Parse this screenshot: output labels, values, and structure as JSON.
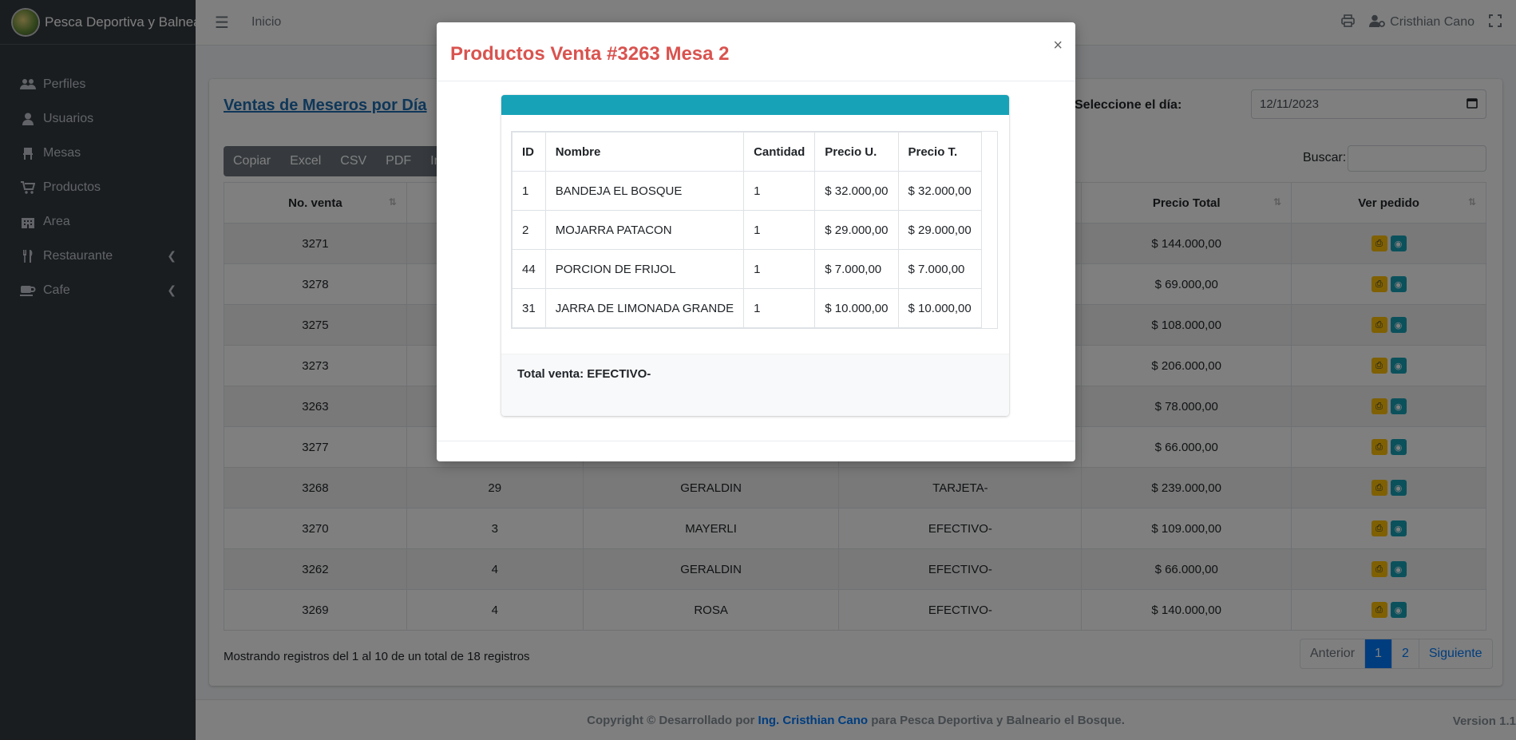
{
  "brand": {
    "title": "Pesca Deportiva y Balneari"
  },
  "sidebar": {
    "items": [
      {
        "label": "Perfiles",
        "icon": "users-icon"
      },
      {
        "label": "Usuarios",
        "icon": "user-icon"
      },
      {
        "label": "Mesas",
        "icon": "chair-icon"
      },
      {
        "label": "Productos",
        "icon": "cart-icon"
      },
      {
        "label": "Area",
        "icon": "building-icon"
      },
      {
        "label": "Restaurante",
        "icon": "utensils-icon"
      },
      {
        "label": "Cafe",
        "icon": "coffee-icon"
      }
    ]
  },
  "topbar": {
    "home": "Inicio",
    "user": "Cristhian Cano"
  },
  "page": {
    "title": "Ventas de Meseros por Día",
    "day_label": "Seleccione el día:",
    "date_value": "12/11/2023",
    "search_label": "Buscar:",
    "export_buttons": [
      "Copiar",
      "Excel",
      "CSV",
      "PDF",
      "Imp"
    ]
  },
  "table": {
    "headers": {
      "c1": "No. venta",
      "c5": "Precio Total",
      "c6": "Ver pedido"
    },
    "rows": [
      {
        "venta": "3271",
        "mesa": "",
        "mesero": "",
        "pago": "",
        "total": "$ 144.000,00"
      },
      {
        "venta": "3278",
        "mesa": "",
        "mesero": "",
        "pago": "",
        "total": "$ 69.000,00"
      },
      {
        "venta": "3275",
        "mesa": "",
        "mesero": "",
        "pago": "",
        "total": "$ 108.000,00"
      },
      {
        "venta": "3273",
        "mesa": "",
        "mesero": "",
        "pago": "",
        "total": "$ 206.000,00"
      },
      {
        "venta": "3263",
        "mesa": "",
        "mesero": "",
        "pago": "",
        "total": "$ 78.000,00"
      },
      {
        "venta": "3277",
        "mesa": "",
        "mesero": "",
        "pago": "",
        "total": "$ 66.000,00"
      },
      {
        "venta": "3268",
        "mesa": "29",
        "mesero": "GERALDIN",
        "pago": "TARJETA-",
        "total": "$ 239.000,00"
      },
      {
        "venta": "3270",
        "mesa": "3",
        "mesero": "MAYERLI",
        "pago": "EFECTIVO-",
        "total": "$ 109.000,00"
      },
      {
        "venta": "3262",
        "mesa": "4",
        "mesero": "GERALDIN",
        "pago": "EFECTIVO-",
        "total": "$ 66.000,00"
      },
      {
        "venta": "3269",
        "mesa": "4",
        "mesero": "ROSA",
        "pago": "EFECTIVO-",
        "total": "$ 140.000,00"
      }
    ],
    "info": "Mostrando registros del 1 al 10 de un total de 18 registros"
  },
  "pager": {
    "prev": "Anterior",
    "p1": "1",
    "p2": "2",
    "next": "Siguiente"
  },
  "footer": {
    "prefix": "Copyright © Desarrollado por",
    "author": "Ing. Cristhian Cano",
    "suffix": "para Pesca Deportiva y Balneario el Bosque.",
    "version": "Version 1.1"
  },
  "modal": {
    "title": "Productos Venta #3263 Mesa 2",
    "close": "×",
    "headers": {
      "id": "ID",
      "nombre": "Nombre",
      "cantidad": "Cantidad",
      "pu": "Precio U.",
      "pt": "Precio T."
    },
    "rows": [
      {
        "id": "1",
        "nombre": "BANDEJA EL BOSQUE",
        "cantidad": "1",
        "pu": "$ 32.000,00",
        "pt": "$ 32.000,00"
      },
      {
        "id": "2",
        "nombre": "MOJARRA PATACON",
        "cantidad": "1",
        "pu": "$ 29.000,00",
        "pt": "$ 29.000,00"
      },
      {
        "id": "44",
        "nombre": "PORCION DE FRIJOL",
        "cantidad": "1",
        "pu": "$ 7.000,00",
        "pt": "$ 7.000,00"
      },
      {
        "id": "31",
        "nombre": "JARRA DE LIMONADA GRANDE",
        "cantidad": "1",
        "pu": "$ 10.000,00",
        "pt": "$ 10.000,00"
      }
    ],
    "total": "Total venta: EFECTIVO-"
  },
  "colors": {
    "accent": "#17a2b8",
    "sidebar": "#343a40",
    "title": "#d9534f"
  }
}
